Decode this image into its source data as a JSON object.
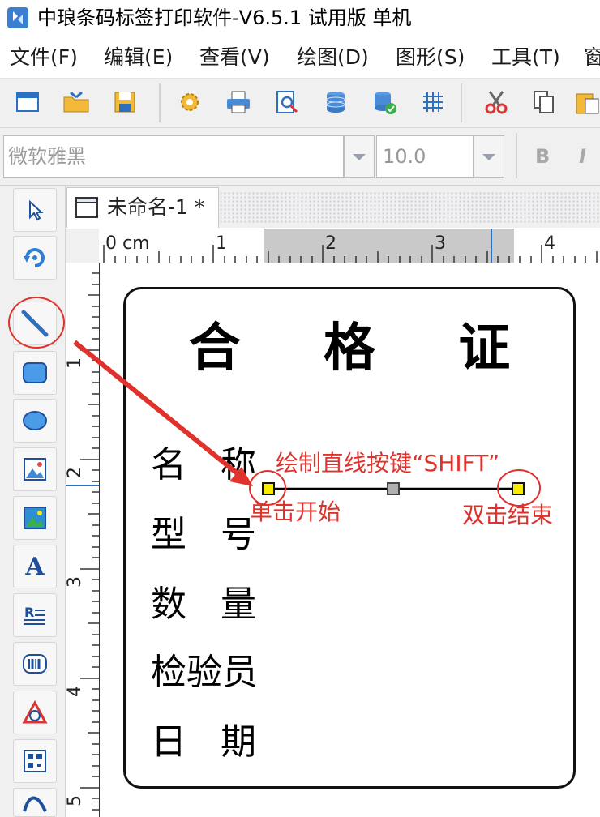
{
  "window": {
    "title": "中琅条码标签打印软件-V6.5.1 试用版 单机"
  },
  "menu": [
    {
      "label": "文件(F)"
    },
    {
      "label": "编辑(E)"
    },
    {
      "label": "查看(V)"
    },
    {
      "label": "绘图(D)"
    },
    {
      "label": "图形(S)"
    },
    {
      "label": "工具(T)"
    },
    {
      "label": "窗"
    }
  ],
  "toolbar": {
    "icons": [
      "new-file-icon",
      "open-folder-icon",
      "save-icon",
      "settings-gear-icon",
      "print-icon",
      "print-preview-icon",
      "database-icon",
      "database-connect-icon",
      "grid-icon",
      "cut-icon",
      "copy-icon",
      "paste-icon"
    ]
  },
  "format": {
    "font_name": "微软雅黑",
    "font_size": "10.0",
    "bold_label": "B",
    "italic_label": "I"
  },
  "palette": {
    "tools": [
      "select-arrow-icon",
      "rotate-icon",
      "line-tool-icon",
      "rectangle-tool-icon",
      "ellipse-tool-icon",
      "image-tool-icon",
      "picture-tool-icon",
      "text-tool-icon",
      "rich-text-tool-icon",
      "barcode-tool-icon",
      "shape-tool-icon",
      "qrcode-tool-icon",
      "curve-tool-icon"
    ],
    "text_tool_glyph": "A"
  },
  "document": {
    "tab_label": "未命名-1 *"
  },
  "ruler": {
    "h_labels": [
      "0 cm",
      "1",
      "2",
      "3",
      "4"
    ],
    "v_labels": [
      "1",
      "2",
      "3",
      "4",
      "5"
    ]
  },
  "label": {
    "title": "合 格 证",
    "fields": [
      "名   称",
      "型   号",
      "数   量",
      "检验员",
      "日   期"
    ]
  },
  "annotations": {
    "draw_line_hint": "绘制直线按键“SHIFT”",
    "click_start": "单击开始",
    "double_click_end": "双击结束"
  },
  "colors": {
    "annotation_red": "#e0322c",
    "handle_yellow": "#f5ec00",
    "handle_gray": "#b0b0b0"
  }
}
